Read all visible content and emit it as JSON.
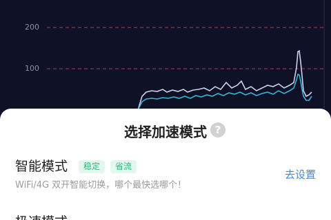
{
  "chart": {
    "y_ticks": [
      "200",
      "100"
    ],
    "series": [
      {
        "color": "#cfd2ee"
      },
      {
        "color": "#3ab4d6"
      }
    ],
    "grid_line_color": "#b03a5a"
  },
  "sheet": {
    "title": "选择加速模式",
    "help_icon": "question-circle-icon",
    "modes": [
      {
        "name": "智能模式",
        "tags": [
          "稳定",
          "省流"
        ],
        "action": "去设置",
        "description": "WiFi/4G 双开智能切换，哪个最快选哪个！"
      },
      {
        "name": "极速模式"
      }
    ]
  }
}
